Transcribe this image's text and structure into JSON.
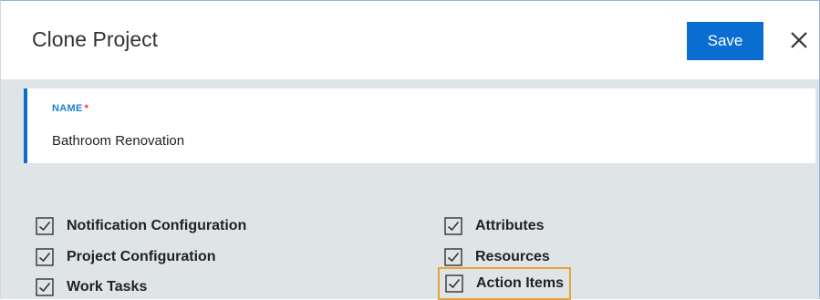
{
  "dialog": {
    "title": "Clone Project",
    "save_label": "Save",
    "close_icon": "close-icon"
  },
  "name_field": {
    "label": "NAME",
    "required_mark": "*",
    "value": "Bathroom Renovation"
  },
  "options": {
    "left": [
      {
        "label": "Notification Configuration",
        "checked": true
      },
      {
        "label": "Project Configuration",
        "checked": true
      },
      {
        "label": "Work Tasks",
        "checked": true
      }
    ],
    "right": [
      {
        "label": "Attributes",
        "checked": true
      },
      {
        "label": "Resources",
        "checked": true
      },
      {
        "label": "Action Items",
        "checked": true,
        "highlighted": true
      }
    ]
  },
  "colors": {
    "accent": "#0a6ed1",
    "highlight": "#e8a33a",
    "required": "#e0332a",
    "panel": "#dfe4e6"
  }
}
